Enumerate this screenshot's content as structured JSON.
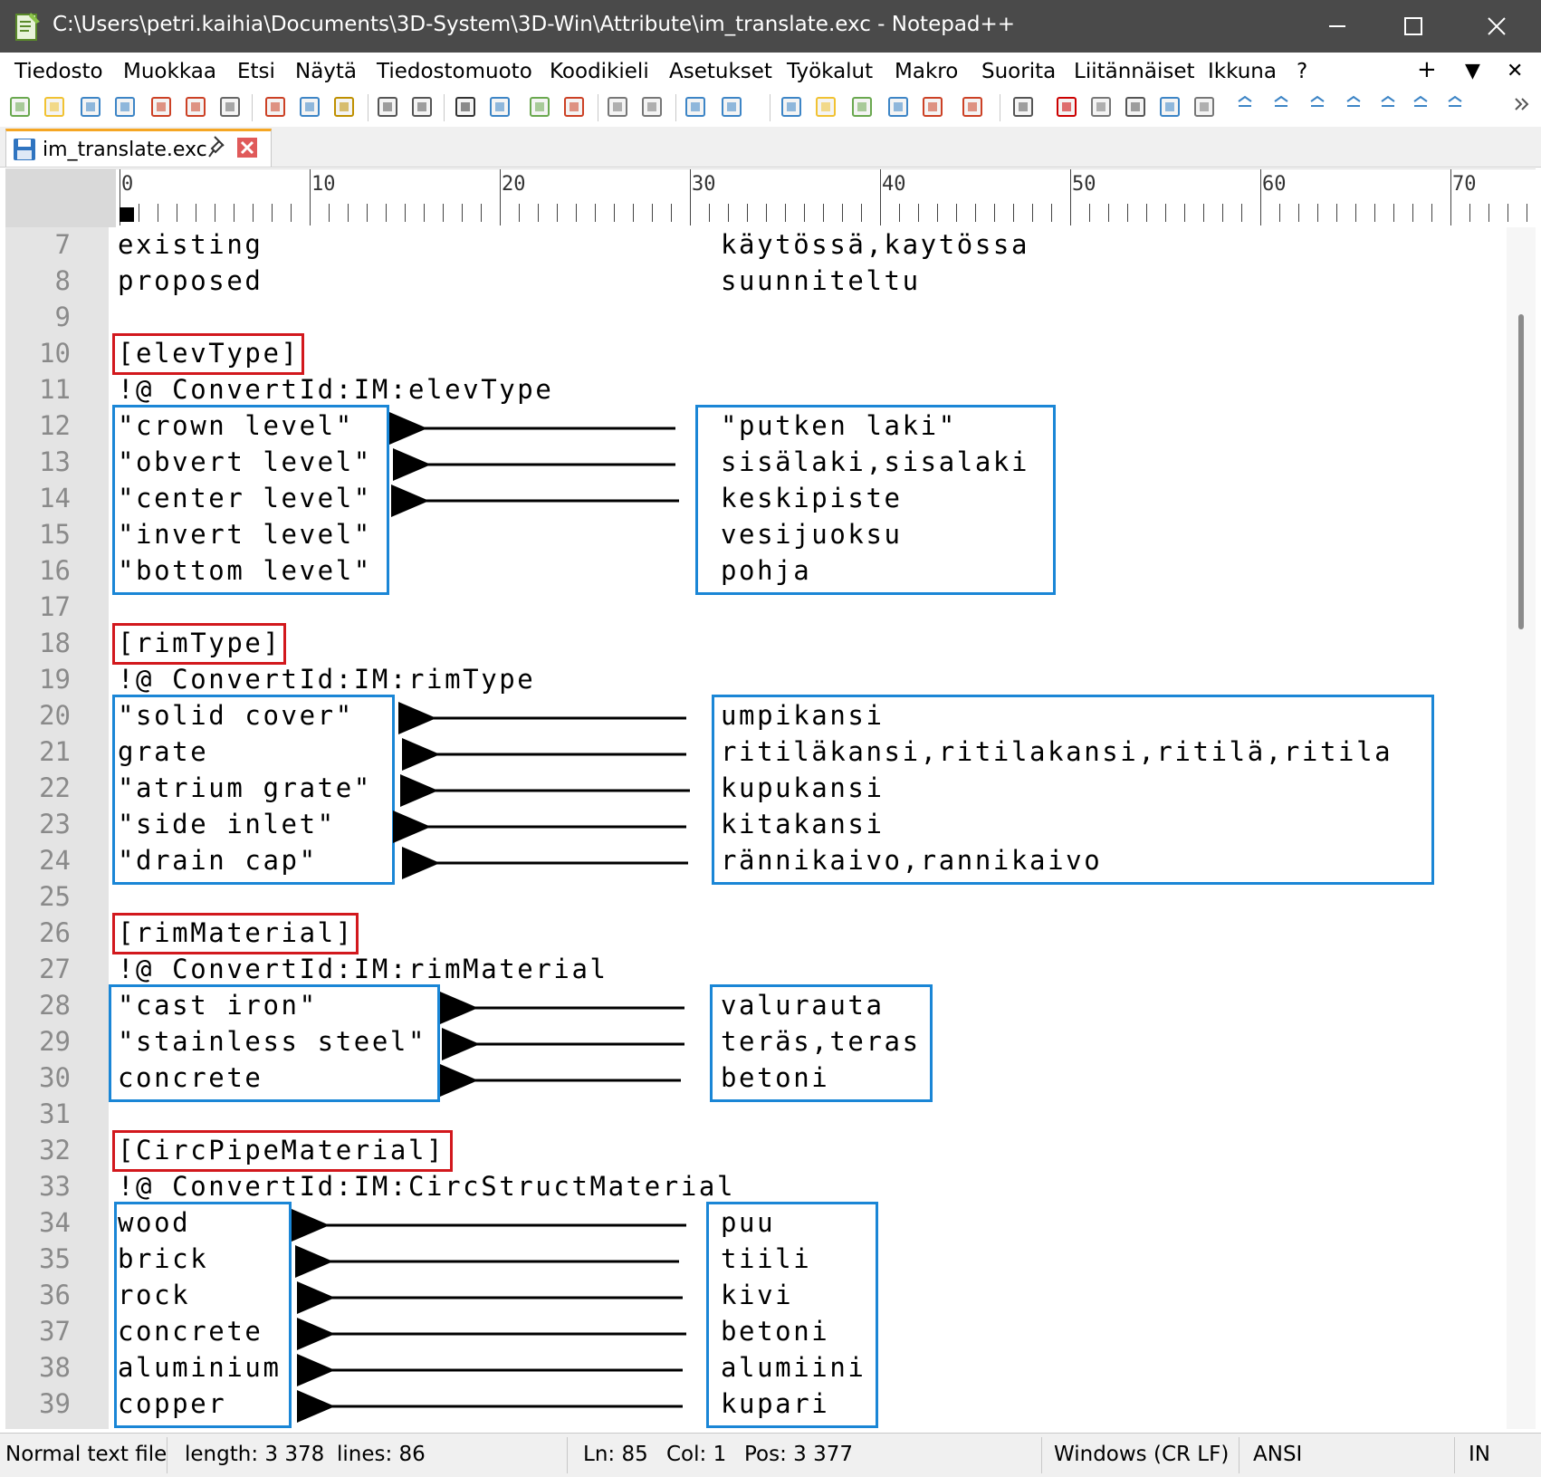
{
  "window": {
    "title": "C:\\Users\\petri.kaihia\\Documents\\3D-System\\3D-Win\\Attribute\\im_translate.exc - Notepad++"
  },
  "menu": [
    "Tiedosto",
    "Muokkaa",
    "Etsi",
    "Näytä",
    "Tiedostomuoto",
    "Koodikieli",
    "Asetukset",
    "Työkalut",
    "Makro",
    "Suorita",
    "Liitännäiset",
    "Ikkuna",
    "?"
  ],
  "menu_right": {
    "add": "+",
    "dropdown": "▼",
    "close": "✕"
  },
  "tab": {
    "label": "im_translate.exc",
    "pin": "📌",
    "close": "✖"
  },
  "ruler": {
    "labels": [
      "0",
      "10",
      "20",
      "30",
      "40",
      "50",
      "60",
      "70"
    ]
  },
  "lines": [
    {
      "n": "7",
      "left": "existing",
      "right": "käytössä,kaytössa"
    },
    {
      "n": "8",
      "left": "proposed",
      "right": "suunniteltu"
    },
    {
      "n": "9",
      "left": "",
      "right": ""
    },
    {
      "n": "10",
      "left": "[elevType]",
      "right": ""
    },
    {
      "n": "11",
      "left": "!@ ConvertId:IM:elevType",
      "right": ""
    },
    {
      "n": "12",
      "left": "\"crown level\"",
      "right": "\"putken laki\""
    },
    {
      "n": "13",
      "left": "\"obvert level\"",
      "right": "sisälaki,sisalaki"
    },
    {
      "n": "14",
      "left": "\"center level\"",
      "right": "keskipiste"
    },
    {
      "n": "15",
      "left": "\"invert level\"",
      "right": "vesijuoksu"
    },
    {
      "n": "16",
      "left": "\"bottom level\"",
      "right": "pohja"
    },
    {
      "n": "17",
      "left": "",
      "right": ""
    },
    {
      "n": "18",
      "left": "[rimType]",
      "right": ""
    },
    {
      "n": "19",
      "left": "!@ ConvertId:IM:rimType",
      "right": ""
    },
    {
      "n": "20",
      "left": "\"solid cover\"",
      "right": "umpikansi"
    },
    {
      "n": "21",
      "left": "grate",
      "right": "ritiläkansi,ritilakansi,ritilä,ritila"
    },
    {
      "n": "22",
      "left": "\"atrium grate\"",
      "right": "kupukansi"
    },
    {
      "n": "23",
      "left": "\"side inlet\"",
      "right": "kitakansi"
    },
    {
      "n": "24",
      "left": "\"drain cap\"",
      "right": "rännikaivo,rannikaivo"
    },
    {
      "n": "25",
      "left": "",
      "right": ""
    },
    {
      "n": "26",
      "left": "[rimMaterial]",
      "right": ""
    },
    {
      "n": "27",
      "left": "!@ ConvertId:IM:rimMaterial",
      "right": ""
    },
    {
      "n": "28",
      "left": "\"cast iron\"",
      "right": "valurauta"
    },
    {
      "n": "29",
      "left": "\"stainless steel\"",
      "right": "teräs,teras"
    },
    {
      "n": "30",
      "left": "concrete",
      "right": "betoni"
    },
    {
      "n": "31",
      "left": "",
      "right": ""
    },
    {
      "n": "32",
      "left": "[CircPipeMaterial]",
      "right": ""
    },
    {
      "n": "33",
      "left": "!@ ConvertId:IM:CircStructMaterial",
      "right": ""
    },
    {
      "n": "34",
      "left": "wood",
      "right": "puu"
    },
    {
      "n": "35",
      "left": "brick",
      "right": "tiili"
    },
    {
      "n": "36",
      "left": "rock",
      "right": "kivi"
    },
    {
      "n": "37",
      "left": "concrete",
      "right": "betoni"
    },
    {
      "n": "38",
      "left": "aluminium",
      "right": "alumiini"
    },
    {
      "n": "39",
      "left": "copper",
      "right": "kupari"
    }
  ],
  "status": {
    "type": "Normal text file",
    "length": "length: 3 378",
    "lines": "lines: 86",
    "ln": "Ln: 85",
    "col": "Col: 1",
    "pos": "Pos: 3 377",
    "eol": "Windows (CR LF)",
    "encoding": "ANSI",
    "mode": "IN"
  },
  "colors": {
    "annotation_red": "#d2181d",
    "annotation_blue": "#1a86d6",
    "titlebar": "#4a4a4a"
  },
  "icons": {
    "toolbar": [
      "new-file-icon",
      "open-file-icon",
      "save-icon",
      "save-all-icon",
      "close-icon",
      "close-all-icon",
      "print-icon",
      "cut-icon",
      "copy-icon",
      "paste-icon",
      "undo-icon",
      "redo-icon",
      "find-icon",
      "replace-icon",
      "zoom-in-icon",
      "zoom-out-icon",
      "sync-v-icon",
      "sync-h-icon",
      "word-wrap-icon",
      "show-all-chars-icon",
      "indent-guide-icon",
      "lang-udl-icon",
      "doc-map-icon",
      "doc-list-icon",
      "function-list-icon",
      "folder-workspace-icon",
      "monitoring-icon",
      "record-macro-icon",
      "stop-macro-icon",
      "play-macro-icon",
      "run-macro-multiple-icon",
      "save-macro-icon"
    ]
  }
}
